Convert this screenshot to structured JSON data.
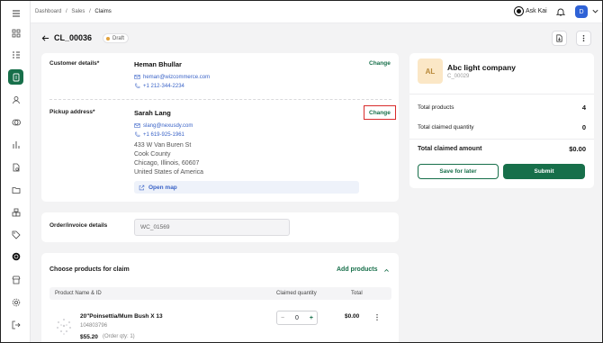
{
  "breadcrumb": {
    "items": [
      "Dashboard",
      "Sales",
      "Claims"
    ],
    "separator": "/"
  },
  "topbar": {
    "ask_label": "Ask Kai",
    "user_initial": "D"
  },
  "header": {
    "title": "CL_00036",
    "status": "Draft"
  },
  "customer": {
    "label": "Customer details*",
    "name": "Heman Bhullar",
    "email": "heman@wizcommerce.com",
    "phone": "+1 212-344-2234",
    "change_label": "Change"
  },
  "pickup": {
    "label": "Pickup address*",
    "name": "Sarah Lang",
    "email": "slang@nexusdy.com",
    "phone": "+1 619-925-1961",
    "address_lines": [
      "433 W Van Buren St",
      "Cook County",
      "Chicago, Illinois, 60607",
      "United States of America"
    ],
    "map_label": "Open map",
    "change_label": "Change"
  },
  "order": {
    "label": "Order/invoice details",
    "value": "WC_01569"
  },
  "products": {
    "title": "Choose products for claim",
    "add_label": "Add products",
    "columns": [
      "Product Name & ID",
      "Claimed quantity",
      "Total"
    ],
    "rows": [
      {
        "name": "20\"Poinsettia/Mum Bush X 13",
        "id": "104803796",
        "price": "$55.20",
        "order_qty": "(Order qty: 1)",
        "qty": "0",
        "total": "$0.00"
      }
    ]
  },
  "summary": {
    "company_initials": "AL",
    "company_name": "Abc light company",
    "company_id": "C_00029",
    "total_products_label": "Total products",
    "total_products": "4",
    "total_claimed_qty_label": "Total claimed quantity",
    "total_claimed_qty": "0",
    "total_amount_label": "Total claimed amount",
    "total_amount": "$0.00",
    "save_label": "Save for later",
    "submit_label": "Submit"
  },
  "colors": {
    "accent": "#176f4a",
    "link": "#3a63c7",
    "highlight": "#d92b2b",
    "avatar": "#2f62d6"
  }
}
